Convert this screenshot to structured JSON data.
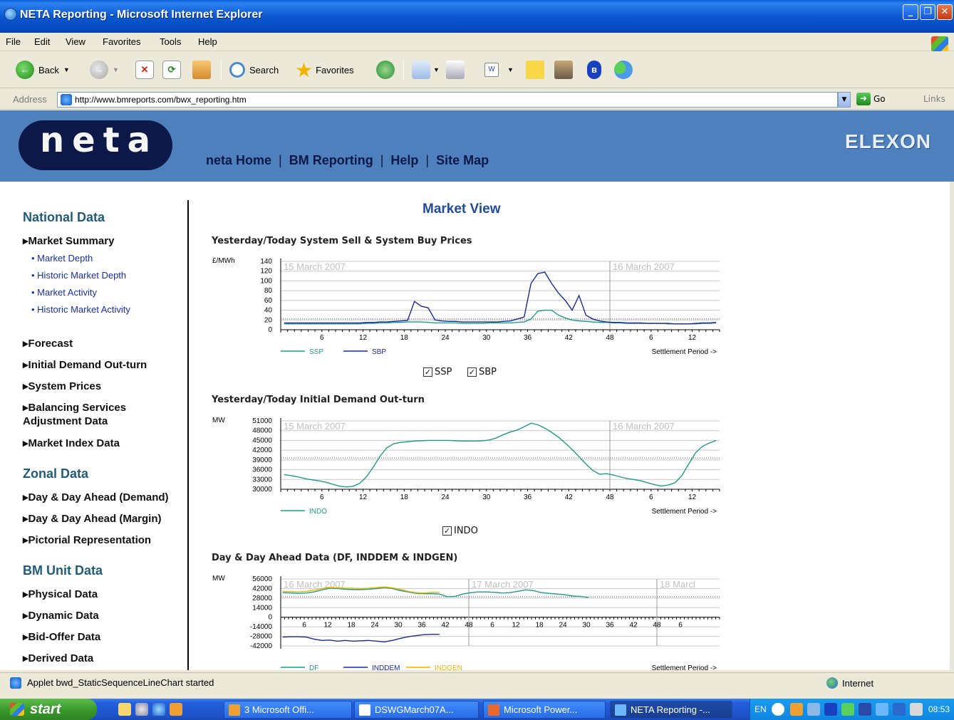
{
  "window": {
    "title": "NETA Reporting - Microsoft Internet Explorer"
  },
  "menu": [
    "File",
    "Edit",
    "View",
    "Favorites",
    "Tools",
    "Help"
  ],
  "toolbar": {
    "back": "Back",
    "search": "Search",
    "favorites": "Favorites"
  },
  "address": {
    "label": "Address",
    "url": "http://www.bmreports.com/bwx_reporting.htm",
    "go": "Go",
    "links": "Links"
  },
  "site": {
    "logo": "neta",
    "nav": [
      "neta Home",
      "BM Reporting",
      "Help",
      "Site Map"
    ],
    "partner": "ELEXON"
  },
  "sidebar": {
    "national": {
      "heading": "National Data",
      "market_summary": "Market Summary",
      "subs": [
        "Market Depth",
        "Historic Market Depth",
        "Market Activity",
        "Historic Market Activity"
      ],
      "items": [
        "Forecast",
        "Initial Demand Out-turn",
        "System Prices",
        "Balancing Services",
        "Adjustment Data",
        "Market Index Data"
      ]
    },
    "zonal": {
      "heading": "Zonal Data",
      "items": [
        "Day & Day Ahead (Demand)",
        "Day & Day Ahead (Margin)",
        "Pictorial Representation"
      ]
    },
    "bmu": {
      "heading": "BM Unit Data",
      "items": [
        "Physical Data",
        "Dynamic Data",
        "Bid-Offer Data",
        "Derived Data"
      ]
    }
  },
  "main": {
    "title": "Market View",
    "chart1_title": "Yesterday/Today System Sell & System Buy Prices",
    "chart2_title": "Yesterday/Today Initial Demand Out-turn",
    "chart3_title": "Day & Day Ahead Data (DF, INDDEM & INDGEN)",
    "checks1": [
      "SSP",
      "SBP"
    ],
    "checks2": [
      "INDO"
    ]
  },
  "chart_data": [
    {
      "type": "line",
      "title": "Yesterday/Today System Sell & System Buy Prices",
      "ylabel": "£/MWh",
      "xlabel": "Settlement Period ->",
      "ylim": [
        0,
        140
      ],
      "yticks": [
        0,
        20,
        40,
        60,
        80,
        100,
        120,
        140
      ],
      "xticks": [
        "6",
        "12",
        "18",
        "24",
        "30",
        "36",
        "42",
        "48",
        "6",
        "12"
      ],
      "date_labels": [
        "15 March 2007",
        "16 March 2007"
      ],
      "series": [
        {
          "name": "SSP",
          "color": "#1E9A8A",
          "values": [
            12,
            12,
            12,
            12,
            12,
            12,
            12,
            12,
            12,
            12,
            12,
            12,
            13,
            13,
            14,
            14,
            15,
            15,
            16,
            16,
            16,
            15,
            14,
            14,
            14,
            14,
            13,
            13,
            13,
            13,
            14,
            14,
            14,
            14,
            15,
            16,
            22,
            38,
            40,
            40,
            30,
            24,
            20,
            18,
            17,
            16,
            15,
            15,
            14,
            14,
            13,
            13,
            13,
            13,
            13,
            13,
            12,
            12,
            12,
            12,
            12,
            13,
            13,
            14
          ]
        },
        {
          "name": "SBP",
          "color": "#1A2A98",
          "values": [
            14,
            14,
            14,
            14,
            14,
            14,
            14,
            14,
            14,
            14,
            14,
            14,
            15,
            15,
            16,
            16,
            17,
            18,
            19,
            58,
            48,
            45,
            20,
            18,
            17,
            17,
            16,
            16,
            16,
            16,
            16,
            16,
            17,
            18,
            22,
            26,
            95,
            115,
            118,
            95,
            75,
            60,
            40,
            70,
            30,
            22,
            18,
            16,
            15,
            15,
            14,
            14,
            14,
            13,
            13,
            13,
            13,
            12,
            12,
            12,
            13,
            14,
            14,
            15
          ]
        }
      ]
    },
    {
      "type": "line",
      "title": "Yesterday/Today Initial Demand Out-turn",
      "ylabel": "MW",
      "xlabel": "Settlement Period ->",
      "ylim": [
        30000,
        51000
      ],
      "yticks": [
        30000,
        33000,
        36000,
        39000,
        42000,
        45000,
        48000,
        51000
      ],
      "xticks": [
        "6",
        "12",
        "18",
        "24",
        "30",
        "36",
        "42",
        "48",
        "6",
        "12"
      ],
      "date_labels": [
        "15 March 2007",
        "16 March 2007"
      ],
      "series": [
        {
          "name": "INDO",
          "color": "#1E9A8A",
          "values": [
            34500,
            34200,
            33800,
            33300,
            32900,
            32600,
            32200,
            31600,
            31000,
            30700,
            30900,
            31800,
            33800,
            36800,
            40200,
            42800,
            44000,
            44400,
            44600,
            44800,
            44900,
            45000,
            45000,
            45000,
            45000,
            44900,
            44800,
            44800,
            44800,
            44900,
            45200,
            45800,
            46800,
            47600,
            48200,
            49200,
            50300,
            49800,
            48800,
            47500,
            46000,
            44200,
            42200,
            40000,
            37800,
            35800,
            34600,
            34800,
            34400,
            33800,
            33300,
            33000,
            32600,
            32000,
            31400,
            31000,
            31300,
            32000,
            34200,
            37800,
            41200,
            43200,
            44200,
            45000
          ]
        }
      ]
    },
    {
      "type": "line",
      "title": "Day & Day Ahead Data (DF, INDDEM & INDGEN)",
      "ylabel": "MW",
      "xlabel": "Settlement Period ->",
      "ylim": [
        -42000,
        56000
      ],
      "yticks": [
        -42000,
        -28000,
        -14000,
        0,
        14000,
        28000,
        42000,
        56000
      ],
      "xticks": [
        "6",
        "12",
        "18",
        "24",
        "30",
        "36",
        "42",
        "48",
        "6",
        "12",
        "18",
        "24",
        "30",
        "36",
        "42",
        "48",
        "6"
      ],
      "date_labels": [
        "16 March 2007",
        "17 March 2007",
        "18 Marcl"
      ],
      "series": [
        {
          "name": "DF",
          "color": "#1E9A8A",
          "values": [
            36000,
            35500,
            35000,
            35500,
            37000,
            40000,
            42500,
            42000,
            41000,
            40500,
            40500,
            41000,
            42000,
            43500,
            42000,
            39000,
            37000,
            35000,
            34500,
            34500,
            34000,
            30000,
            30500,
            34000,
            36000,
            37000,
            37000,
            36500,
            35500,
            36000,
            38000,
            40000,
            39000,
            36000,
            35000,
            34000,
            33000,
            31000,
            30500,
            29000
          ]
        },
        {
          "name": "INDDEM",
          "color": "#1A2A98",
          "values": [
            -29000,
            -28500,
            -28500,
            -29000,
            -32000,
            -34000,
            -33500,
            -35000,
            -34000,
            -35000,
            -34500,
            -34000,
            -35000,
            -36000,
            -34000,
            -31000,
            -28500,
            -27000,
            -25500,
            -25000,
            -25000
          ]
        },
        {
          "name": "INDGEN",
          "color": "#F0B400",
          "values": [
            38000,
            37500,
            37000,
            38000,
            39500,
            42000,
            43500,
            43000,
            42500,
            42500,
            42000,
            42500,
            43500,
            44500,
            43000,
            41000,
            38000,
            36000,
            35500,
            36500,
            36500
          ]
        }
      ]
    }
  ],
  "status": {
    "text": "Applet bwd_StaticSequenceLineChart started",
    "zone": "Internet"
  },
  "taskbar": {
    "start": "start",
    "tasks": [
      "3 Microsoft Offi...",
      "DSWGMarch07A...",
      "Microsoft Power...",
      "NETA Reporting -..."
    ],
    "lang": "EN",
    "clock": "08:53"
  },
  "colors": {
    "banner": "#4E80BD",
    "logo_pill": "#0C1848",
    "heading": "#1F5C7C",
    "link": "#1A2FA8"
  }
}
